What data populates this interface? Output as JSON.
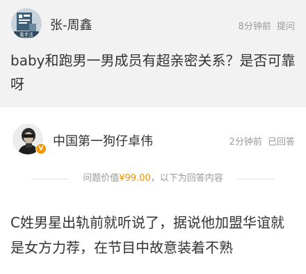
{
  "question": {
    "author": "张-周鑫",
    "time": "8分钟前",
    "action": "提问",
    "text": "baby和跑男一男成员有超亲密关系？是否可靠呀",
    "avatar_label": "看手法"
  },
  "answer": {
    "author": "中国第一狗仔卓伟",
    "time": "2分钟前",
    "status": "已回答",
    "price_prefix": "问题价值",
    "price": "¥99.00",
    "price_suffix": "，以下为回答内容",
    "text": "C姓男星出轨前就听说了，据说他加盟华谊就是女方力荐，在节目中故意装着不熟"
  },
  "colors": {
    "question_bg": "#f2f2f2",
    "price": "#f29100",
    "meta": "#999999",
    "verified_badge": "#f39800"
  },
  "icons": {
    "verified": "verified-badge-icon"
  }
}
